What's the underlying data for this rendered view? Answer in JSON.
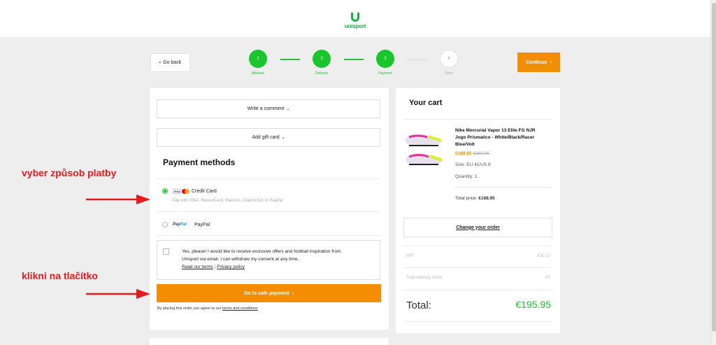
{
  "brand": {
    "name": "unisport",
    "color": "#17b34a"
  },
  "nav": {
    "back_label": "Go back",
    "continue_label": "Continue"
  },
  "steps": [
    {
      "number": "1",
      "label": "Address",
      "state": "done"
    },
    {
      "number": "2",
      "label": "Delivery",
      "state": "done"
    },
    {
      "number": "3",
      "label": "Payment",
      "state": "done"
    },
    {
      "number": "4",
      "label": "Done",
      "state": "todo"
    }
  ],
  "form": {
    "comment_label": "Write a comment",
    "gift_card_label": "Add gift card",
    "payment_title": "Payment methods",
    "methods": [
      {
        "label": "Credit Card",
        "description": "Pay with VISA, MasterCard, Maestro, DinersClub or PayPal",
        "selected": true
      },
      {
        "label": "PayPal",
        "selected": false
      }
    ],
    "consent_text_1": "Yes, please! I would like to receive exclusive offers and football inspiration from",
    "consent_text_2": "Unisport via email. I can withdraw my consent at any time.",
    "terms_link": "Read our terms",
    "separator": "|",
    "privacy_link": "Privacy policy",
    "pay_button": "Go to safe payment",
    "footer_text": "By placing this order you agree to our",
    "footer_link": "terms and conditions"
  },
  "cart": {
    "title": "Your cart",
    "product_name_1": "Nike Mercurial Vapor 13 Elite FG NJR",
    "product_name_2": "Jogo Prismatico - White/Black/Racer",
    "product_name_3": "Blue/Volt",
    "price": "€188.95",
    "old_price": "€269.95",
    "size": "Size: EU 41/US 8",
    "quantity": "Quantity: 1",
    "total_price_label": "Total price:",
    "total_price_value": "€188.95",
    "change_order": "Change your order",
    "vat_label": "VAT:",
    "vat_value": "€30.17",
    "delivery_label": "Total delivery costs:",
    "delivery_value": "€7",
    "total_label": "Total:",
    "total_value": "€195.95"
  },
  "annotations": {
    "choose_payment": "vyber způsob platby",
    "click_button": "klikni na tlačítko",
    "color": "#e8191b"
  },
  "colors": {
    "accent_orange": "#f58d03",
    "accent_green": "#19c62b"
  }
}
